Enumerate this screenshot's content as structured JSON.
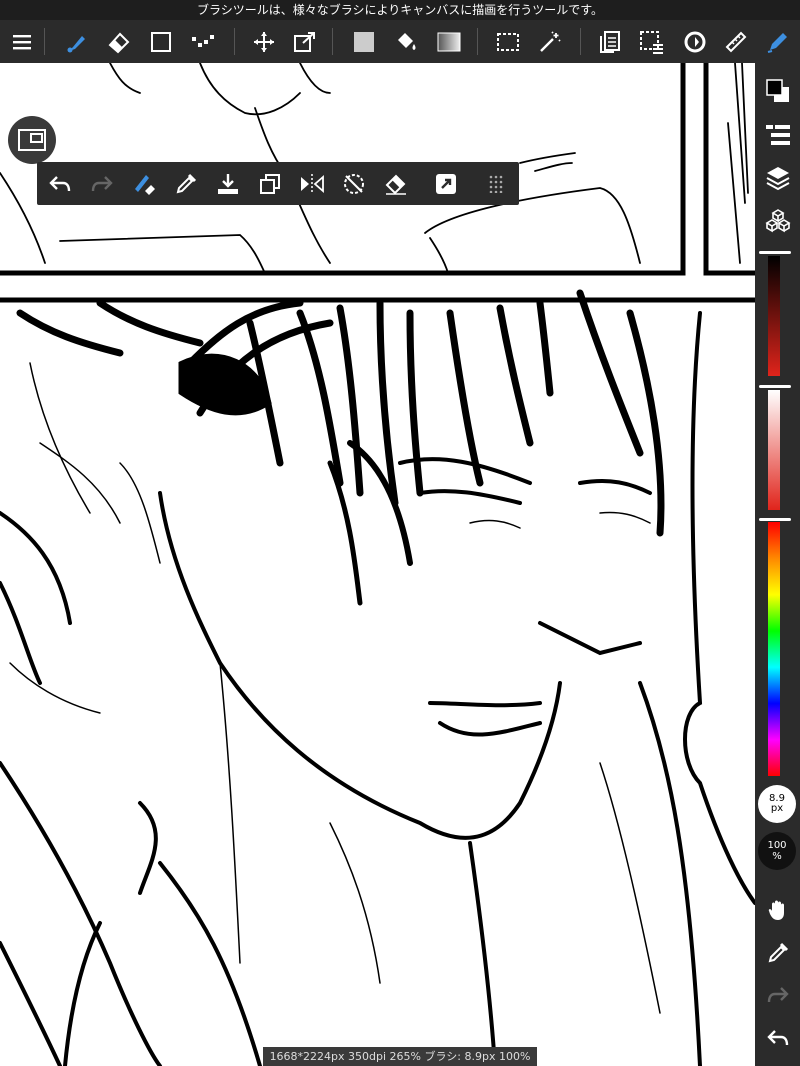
{
  "hint": {
    "text": "ブラシツールは、様々なブラシによりキャンバスに描画を行うツールです。"
  },
  "toolbar": {
    "tools": [
      {
        "name": "menu-icon"
      },
      {
        "name": "brush-icon",
        "active": true
      },
      {
        "name": "eraser-icon"
      },
      {
        "name": "shape-icon"
      },
      {
        "name": "dot-icon"
      },
      {
        "name": "move-icon"
      },
      {
        "name": "transform-icon"
      },
      {
        "name": "fill-color-icon"
      },
      {
        "name": "bucket-icon"
      },
      {
        "name": "gradient-icon"
      },
      {
        "name": "select-icon"
      },
      {
        "name": "magic-wand-icon"
      },
      {
        "name": "copy-icon"
      },
      {
        "name": "select-menu-icon"
      },
      {
        "name": "rotate-icon"
      },
      {
        "name": "ruler-icon"
      },
      {
        "name": "pen-icon"
      }
    ]
  },
  "quick_bar": {
    "tools": [
      {
        "name": "undo-icon"
      },
      {
        "name": "redo-icon"
      },
      {
        "name": "brush-eraser-toggle-icon"
      },
      {
        "name": "eyedropper-icon"
      },
      {
        "name": "save-icon"
      },
      {
        "name": "copy-layer-icon"
      },
      {
        "name": "flip-icon"
      },
      {
        "name": "rotate-reset-icon"
      },
      {
        "name": "clear-icon"
      },
      {
        "name": "shortcut-icon"
      },
      {
        "name": "grip-icon"
      }
    ]
  },
  "right_panel": {
    "brush_size": {
      "value": "8.9",
      "unit": "px"
    },
    "opacity": {
      "value": "100",
      "unit": "%"
    }
  },
  "status": {
    "text": "1668*2224px 350dpi 265% ブラシ: 8.9px 100%"
  },
  "colors": {
    "accent": "#3d8fe0",
    "panel": "#2b2b2b",
    "hue_red": "#e0241b"
  }
}
